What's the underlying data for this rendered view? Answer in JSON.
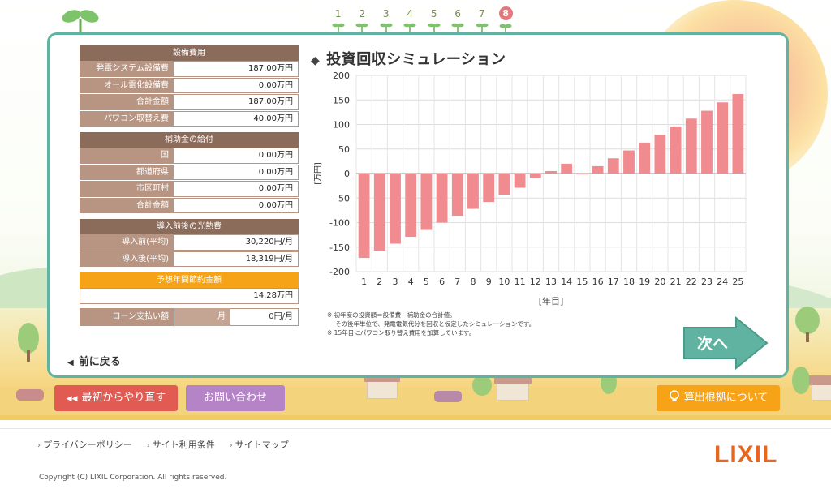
{
  "steps": [
    "1",
    "2",
    "3",
    "4",
    "5",
    "6",
    "7",
    "8"
  ],
  "active_step": "8",
  "colors": {
    "panel_border": "#5fb3a0",
    "bar": "#f08b8f",
    "brown": "#8b6b5a",
    "orange": "#f6a317",
    "logo": "#e8671e"
  },
  "equipment": {
    "header": "設備費用",
    "rows": [
      {
        "label": "発電システム設備費",
        "value": "187.00万円"
      },
      {
        "label": "オール電化設備費",
        "value": "0.00万円"
      },
      {
        "label": "合計金額",
        "value": "187.00万円"
      },
      {
        "label": "パワコン取替え費",
        "value": "40.00万円"
      }
    ]
  },
  "subsidy": {
    "header": "補助金の給付",
    "rows": [
      {
        "label": "国",
        "value": "0.00万円"
      },
      {
        "label": "都道府県",
        "value": "0.00万円"
      },
      {
        "label": "市区町村",
        "value": "0.00万円"
      },
      {
        "label": "合計金額",
        "value": "0.00万円"
      }
    ]
  },
  "utility": {
    "header": "導入前後の光熱費",
    "rows": [
      {
        "label": "導入前(平均)",
        "value": "30,220円/月"
      },
      {
        "label": "導入後(平均)",
        "value": "18,319円/月"
      }
    ]
  },
  "savings": {
    "header": "予想年間節約金額",
    "value": "14.28万円"
  },
  "loan": {
    "label": "ローン支払い額",
    "unit": "月",
    "value": "0円/月"
  },
  "chart_title": "投資回収シミュレーション",
  "chart_data": {
    "type": "bar",
    "title": "投資回収シミュレーション",
    "xlabel": "[年目]",
    "ylabel": "[万円]",
    "ylim": [
      -200,
      200
    ],
    "yticks": [
      -200,
      -150,
      -100,
      -50,
      0,
      50,
      100,
      150,
      200
    ],
    "grid": true,
    "categories": [
      "1",
      "2",
      "3",
      "4",
      "5",
      "6",
      "7",
      "8",
      "9",
      "10",
      "11",
      "12",
      "13",
      "14",
      "15",
      "16",
      "17",
      "18",
      "19",
      "20",
      "21",
      "22",
      "23",
      "24",
      "25"
    ],
    "values": [
      -172,
      -157,
      -143,
      -129,
      -115,
      -100,
      -86,
      -72,
      -58,
      -43,
      -29,
      -10,
      5,
      20,
      0,
      15,
      31,
      47,
      63,
      79,
      96,
      112,
      128,
      145,
      162
    ]
  },
  "notes": [
    "※ 初年度の投資額＝設備費－補助金の合計値。",
    "その後年単位で、発電電気代分を回収と仮定したシミュレーションです。",
    "※ 15年目にパワコン取り替え費用を加算しています。"
  ],
  "back_label": "前に戻る",
  "next_label": "次へ",
  "buttons": {
    "restart": "最初からやり直す",
    "contact": "お問い合わせ",
    "basis": "算出根拠について"
  },
  "footer": {
    "links": [
      "プライバシーポリシー",
      "サイト利用条件",
      "サイトマップ"
    ],
    "copyright": "Copyright (C) LIXIL Corporation. All rights reserved.",
    "logo": "LIXIL"
  }
}
